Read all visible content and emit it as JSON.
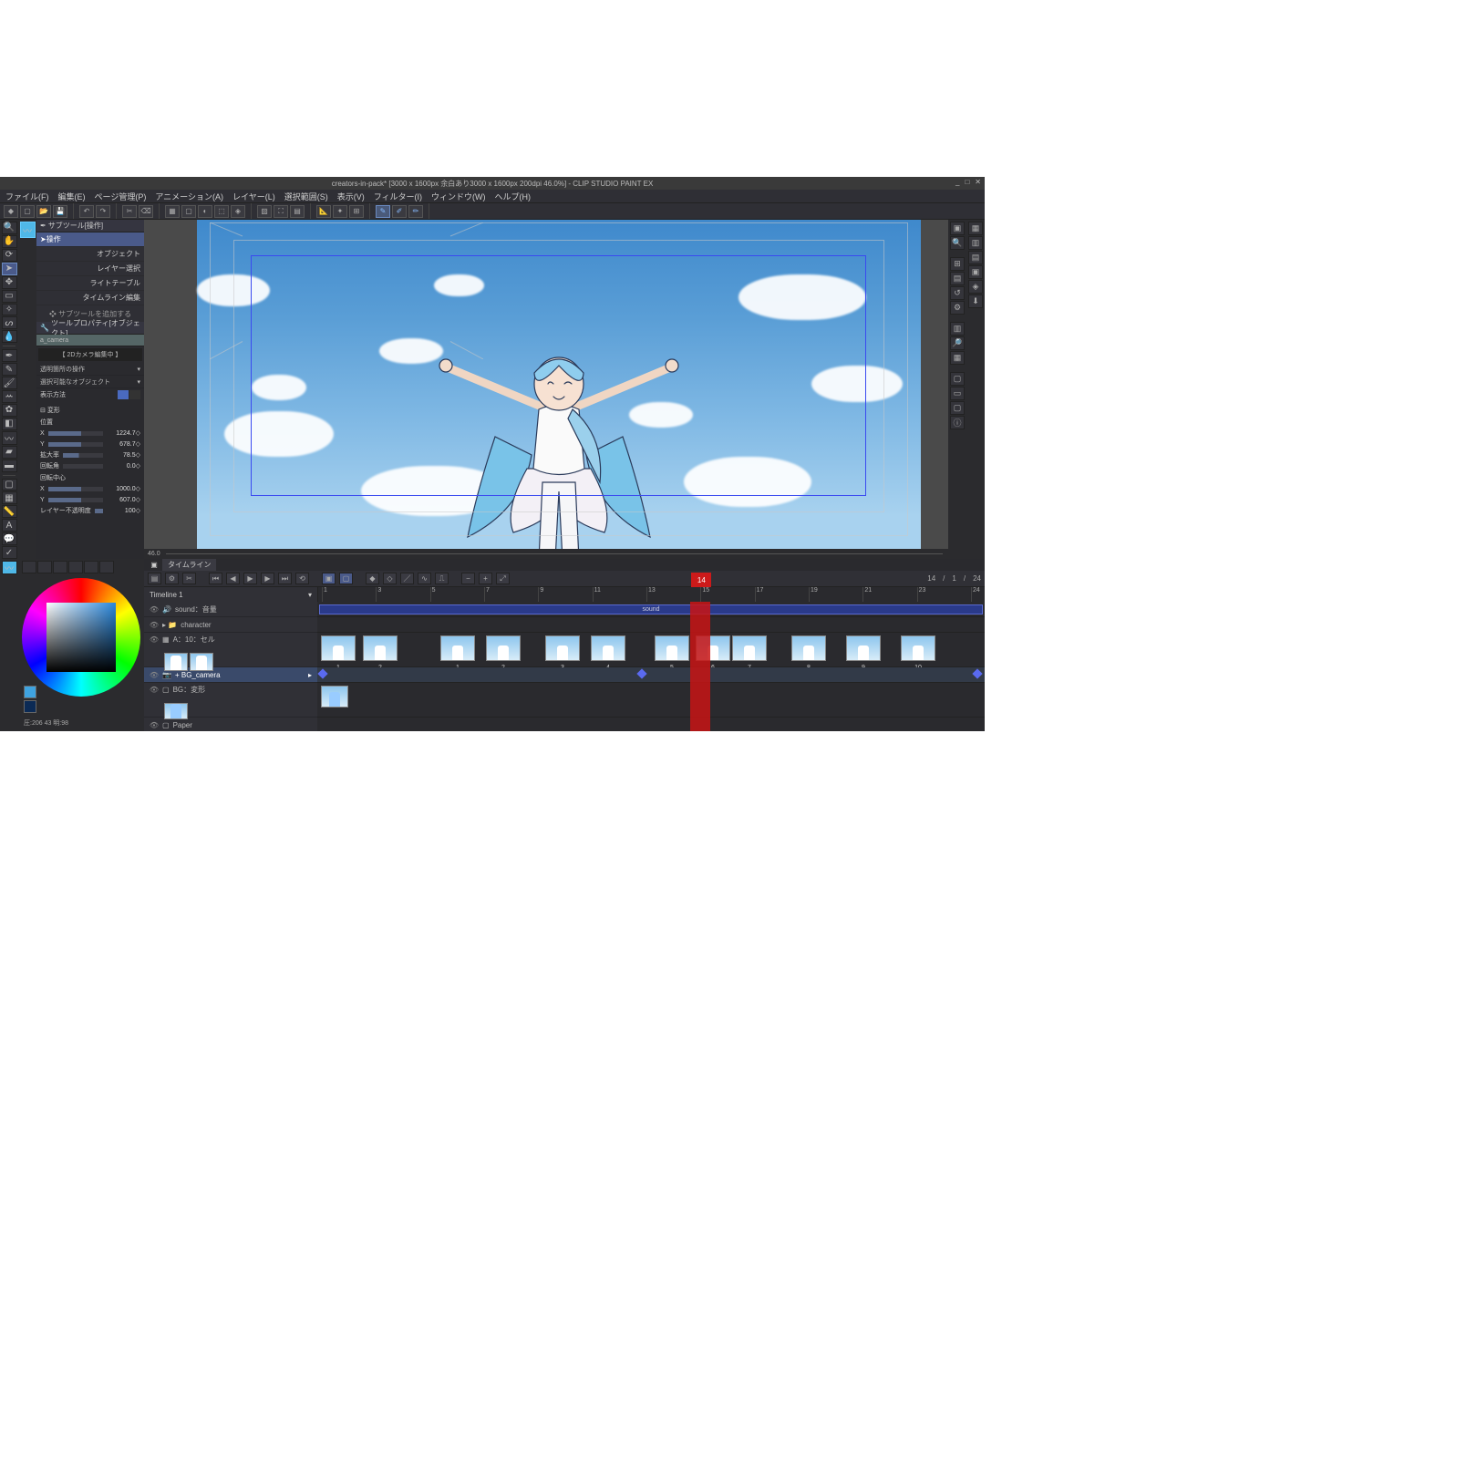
{
  "window": {
    "title": "creators-in-pack* [3000 x 1600px 余白あり3000 x 1600px 200dpi 46.0%] - CLIP STUDIO PAINT EX"
  },
  "menu": {
    "file": "ファイル(F)",
    "edit": "編集(E)",
    "page": "ページ管理(P)",
    "anim": "アニメーション(A)",
    "layer": "レイヤー(L)",
    "select": "選択範囲(S)",
    "view": "表示(V)",
    "filter": "フィルター(I)",
    "window": "ウィンドウ(W)",
    "help": "ヘルプ(H)"
  },
  "subtool": {
    "panel_title": "サブツール[操作]",
    "group": "操作",
    "items": [
      "オブジェクト",
      "レイヤー選択",
      "ライトテーブル",
      "タイムライン編集"
    ],
    "add": "❖ サブツールを追加する"
  },
  "toolprop": {
    "panel_title": "ツールプロパティ[オブジェクト]",
    "tab": "a_camera",
    "editing_box": "【 2Dカメラ編集中 】",
    "field1": "透明箇所の操作",
    "field2": "選択可能なオブジェクト",
    "display_label": "表示方法",
    "transform_header": "変形",
    "pos_label": "位置",
    "x_label": "X",
    "x_val": "1224.7",
    "y_label": "Y",
    "y_val": "678.7",
    "scale_label": "拡大率",
    "scale_val": "78.5",
    "rot_label": "回転角",
    "rot_val": "0.0",
    "center_label": "回転中心",
    "cx_label": "X",
    "cx_val": "1000.0",
    "cy_label": "Y",
    "cy_val": "607.0",
    "opacity_label": "レイヤー不透明度",
    "opacity_val": "100"
  },
  "ruler_start": "46.0",
  "color": {
    "status": "圧:206 43 明:98"
  },
  "timeline": {
    "tab": "タイムライン",
    "name": "Timeline 1",
    "info_frame": "14",
    "info_sep1": "/",
    "info_total": "1",
    "info_sep2": "/",
    "info_fps": "24",
    "playhead_label": "14\n15",
    "ticks": [
      "1",
      "3",
      "5",
      "7",
      "9",
      "11",
      "13",
      "15",
      "17",
      "19",
      "21",
      "23",
      "24"
    ],
    "layers": {
      "sound": "sound：音量",
      "sound_clip": "sound",
      "character": "character",
      "cel_a": "A：10：セル",
      "cel_thumbs": [
        "1",
        "2",
        "1",
        "2",
        "3",
        "4",
        "5",
        "6",
        "7",
        "8",
        "9",
        "10"
      ],
      "bg_camera": "+ BG_camera",
      "bg_transform": "BG：変形",
      "paper": "Paper"
    }
  }
}
